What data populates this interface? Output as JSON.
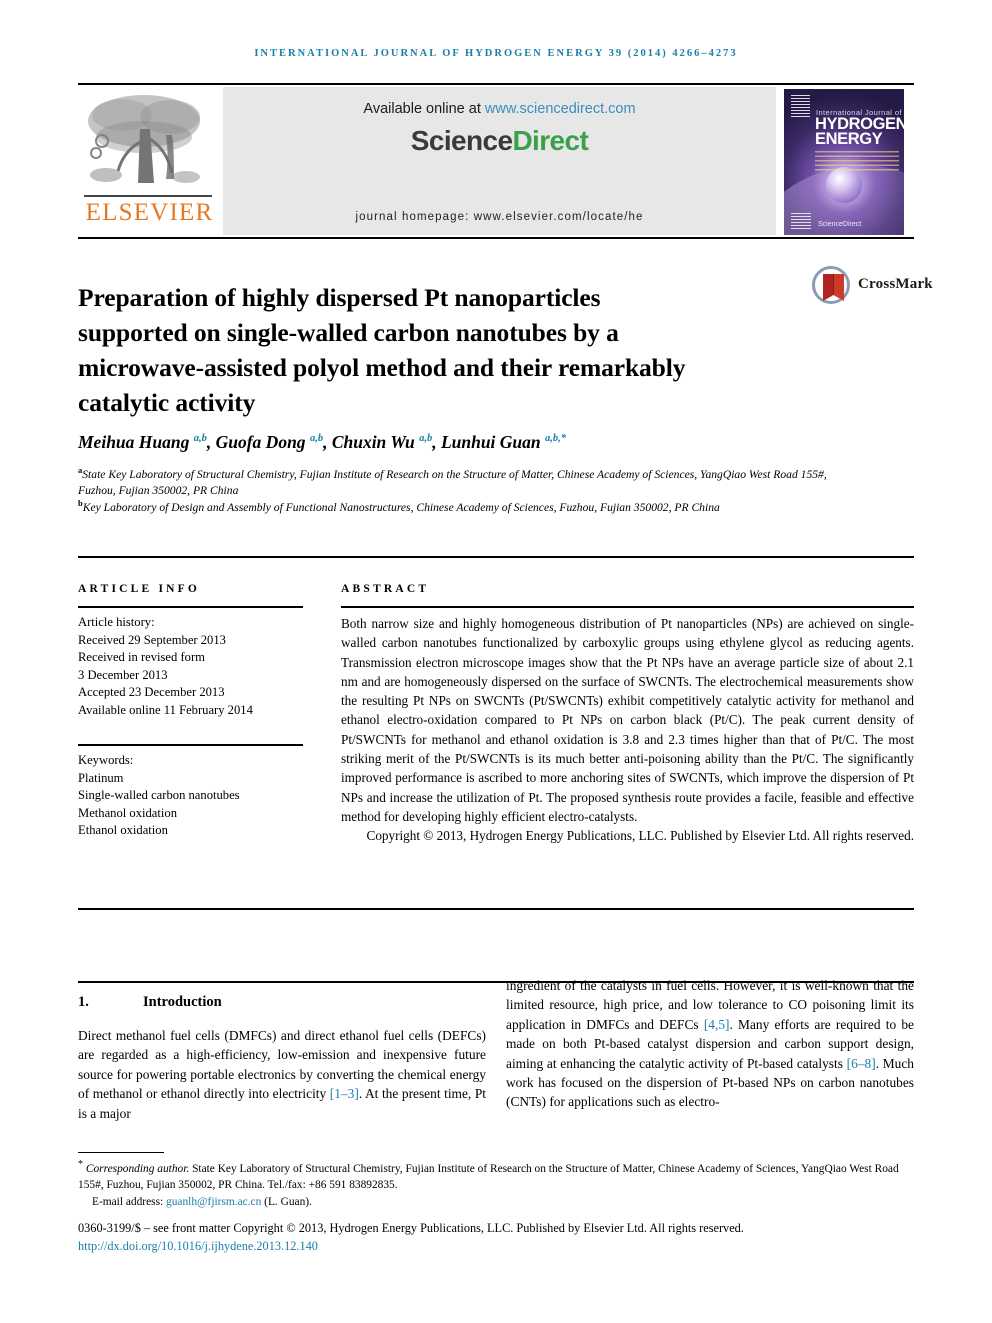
{
  "running_head": "International Journal of Hydrogen Energy 39 (2014) 4266–4273",
  "masthead": {
    "publisher_name": "ELSEVIER",
    "available_prefix": "Available online at ",
    "available_url": "www.sciencedirect.com",
    "sciencedirect_part1": "Science",
    "sciencedirect_part2": "Direct",
    "journal_homepage": "journal homepage: www.elsevier.com/locate/he",
    "cover": {
      "line_small": "International Journal of",
      "title_line1": "HYDROGEN",
      "title_line2": "ENERGY",
      "bottom_text": "ScienceDirect"
    }
  },
  "crossmark": {
    "label": "CrossMark"
  },
  "article": {
    "title": "Preparation of highly dispersed Pt nanoparticles supported on single-walled carbon nanotubes by a microwave-assisted polyol method and their remarkably catalytic activity",
    "authors_html": "Meihua Huang <sup>a,b</sup>, Guofa Dong <sup>a,b</sup>, Chuxin Wu <sup>a,b</sup>, Lunhui Guan <sup>a,b,*</sup>",
    "affiliation_a": "State Key Laboratory of Structural Chemistry, Fujian Institute of Research on the Structure of Matter, Chinese Academy of Sciences, YangQiao West Road 155#, Fuzhou, Fujian 350002, PR China",
    "affiliation_b": "Key Laboratory of Design and Assembly of Functional Nanostructures, Chinese Academy of Sciences, Fuzhou, Fujian 350002, PR China",
    "affil_marker_a": "a",
    "affil_marker_b": "b"
  },
  "article_info": {
    "heading": "ARTICLE INFO",
    "history_label": "Article history:",
    "history": [
      "Received 29 September 2013",
      "Received in revised form",
      "3 December 2013",
      "Accepted 23 December 2013",
      "Available online 11 February 2014"
    ],
    "keywords_label": "Keywords:",
    "keywords": [
      "Platinum",
      "Single-walled carbon nanotubes",
      "Methanol oxidation",
      "Ethanol oxidation"
    ]
  },
  "abstract": {
    "heading": "ABSTRACT",
    "body": "Both narrow size and highly homogeneous distribution of Pt nanoparticles (NPs) are achieved on single-walled carbon nanotubes functionalized by carboxylic groups using ethylene glycol as reducing agents. Transmission electron microscope images show that the Pt NPs have an average particle size of about 2.1 nm and are homogeneously dispersed on the surface of SWCNTs. The electrochemical measurements show the resulting Pt NPs on SWCNTs (Pt/SWCNTs) exhibit competitively catalytic activity for methanol and ethanol electro-oxidation compared to Pt NPs on carbon black (Pt/C). The peak current density of Pt/SWCNTs for methanol and ethanol oxidation is 3.8 and 2.3 times higher than that of Pt/C. The most striking merit of the Pt/SWCNTs is its much better anti-poisoning ability than the Pt/C. The significantly improved performance is ascribed to more anchoring sites of SWCNTs, which improve the dispersion of Pt NPs and increase the utilization of Pt. The proposed synthesis route provides a facile, feasible and effective method for developing highly efficient electro-catalysts.",
    "copyright": "Copyright © 2013, Hydrogen Energy Publications, LLC. Published by Elsevier Ltd. All rights reserved."
  },
  "introduction": {
    "number": "1.",
    "heading": "Introduction",
    "left_column_html": "Direct methanol fuel cells (DMFCs) and direct ethanol fuel cells (DEFCs) are regarded as a high-efficiency, low-emission and inexpensive future source for powering portable electronics by converting the chemical energy of methanol or ethanol directly into electricity <span class=\"ref\">[1–3]</span>. At the present time, Pt is a major",
    "right_column_html": "ingredient of the catalysts in fuel cells. However, it is well-known that the limited resource, high price, and low tolerance to CO poisoning limit its application in DMFCs and DEFCs <span class=\"ref\">[4,5]</span>. Many efforts are required to be made on both Pt-based catalyst dispersion and carbon support design, aiming at enhancing the catalytic activity of Pt-based catalysts <span class=\"ref\">[6–8]</span>. Much work has focused on the dispersion of Pt-based NPs on carbon nanotubes (CNTs) for applications such as electro-"
  },
  "footnote": {
    "star": "*",
    "corresponding_label": "Corresponding author.",
    "corresponding_text": " State Key Laboratory of Structural Chemistry, Fujian Institute of Research on the Structure of Matter, Chinese Academy of Sciences, YangQiao West Road 155#, Fuzhou, Fujian 350002, PR China. Tel./fax: +86 591 83892835.",
    "email_label": "E-mail address: ",
    "email": "guanlh@fjirsm.ac.cn",
    "email_suffix": " (L. Guan)."
  },
  "issn_block": {
    "line1": "0360-3199/$ – see front matter Copyright © 2013, Hydrogen Energy Publications, LLC. Published by Elsevier Ltd. All rights reserved.",
    "doi": "http://dx.doi.org/10.1016/j.ijhydene.2013.12.140"
  },
  "colors": {
    "link_blue": "#1a7fa8",
    "sciencedirect_green": "#3aa14a",
    "elsevier_orange": "#e87722",
    "url_blue": "#3c8dbc"
  }
}
